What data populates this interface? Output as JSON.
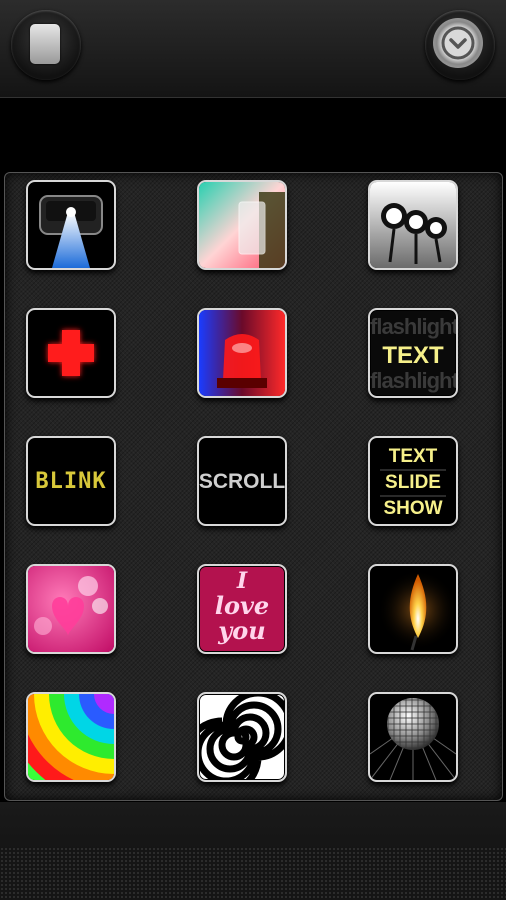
{
  "header": {
    "left_button_icon": "phone-icon",
    "right_button_icon": "chevron-down-circle-icon"
  },
  "colors": {
    "panel_bg": "#242424",
    "tile_border": "#d8d8d8",
    "label_yellow": "#f6f08a"
  },
  "tiles": {
    "text": {
      "label": "TEXT",
      "bg_words": "flashlight"
    },
    "blink": {
      "label": "BLINK"
    },
    "scroll": {
      "label": "SCROLL"
    },
    "slideshow": {
      "line1": "TEXT",
      "line2": "SLIDE",
      "line3": "SHOW"
    },
    "love": {
      "line1": "I",
      "line2": "love",
      "line3": "you"
    }
  }
}
